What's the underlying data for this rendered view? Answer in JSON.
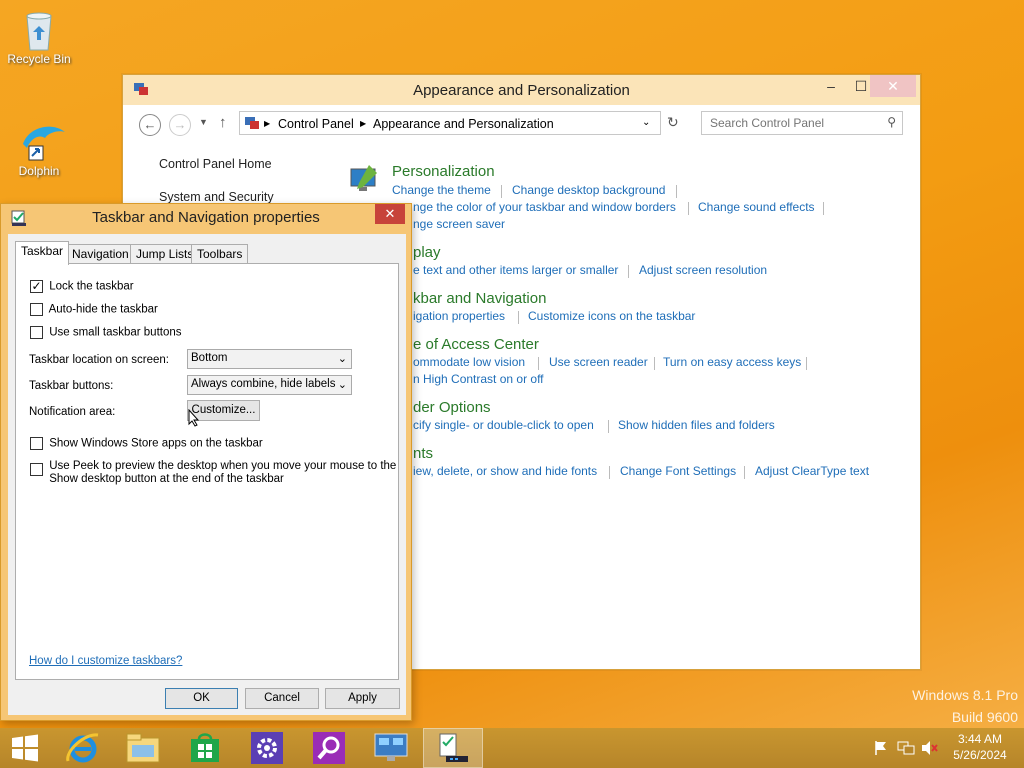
{
  "desktop": {
    "icons": [
      {
        "label": "Recycle Bin",
        "icon": "recycle-bin-icon"
      },
      {
        "label": "Dolphin",
        "icon": "dolphin-icon"
      }
    ],
    "watermark": {
      "line1": "Windows 8.1 Pro",
      "line2": "Build 9600"
    }
  },
  "control_panel": {
    "title": "Appearance and Personalization",
    "breadcrumb": [
      "Control Panel",
      "Appearance and Personalization"
    ],
    "search_placeholder": "Search Control Panel",
    "sidebar": [
      "Control Panel Home",
      "System and Security"
    ],
    "categories": [
      {
        "title": "Personalization",
        "links": [
          "Change the theme",
          "Change desktop background",
          "Change the color of your taskbar and window borders",
          "Change sound effects",
          "Change screen saver"
        ]
      },
      {
        "title": "Display",
        "links": [
          "Make text and other items larger or smaller",
          "Adjust screen resolution"
        ]
      },
      {
        "title": "Taskbar and Navigation",
        "links": [
          "Navigation properties",
          "Customize icons on the taskbar"
        ]
      },
      {
        "title": "Ease of Access Center",
        "links": [
          "Accommodate low vision",
          "Use screen reader",
          "Turn on easy access keys",
          "Turn High Contrast on or off"
        ]
      },
      {
        "title": "Folder Options",
        "links": [
          "Specify single- or double-click to open",
          "Show hidden files and folders"
        ]
      },
      {
        "title": "Fonts",
        "links": [
          "Preview, delete, or show and hide fonts",
          "Change Font Settings",
          "Adjust ClearType text"
        ]
      }
    ],
    "visible_text": {
      "personalization_title": "Personalization",
      "p1": "Change the theme",
      "p2": "Change desktop background",
      "p3": "nge the color of your taskbar and window borders",
      "p4": "Change sound effects",
      "p5": "nge screen saver",
      "display_title": "play",
      "d1": "e text and other items larger or smaller",
      "d2": "Adjust screen resolution",
      "taskbar_title": "kbar and Navigation",
      "t1": "igation properties",
      "t2": "Customize icons on the taskbar",
      "ease_title": "e of Access Center",
      "e1": "ommodate low vision",
      "e2": "Use screen reader",
      "e3": "Turn on easy access keys",
      "e4": "n High Contrast on or off",
      "folder_title": "der Options",
      "f1": "cify single- or double-click to open",
      "f2": "Show hidden files and folders",
      "fonts_title": "nts",
      "fo1": "iew, delete, or show and hide fonts",
      "fo2": "Change Font Settings",
      "fo3": "Adjust ClearType text"
    }
  },
  "dialog": {
    "title": "Taskbar and Navigation properties",
    "tabs": [
      "Taskbar",
      "Navigation",
      "Jump Lists",
      "Toolbars"
    ],
    "checkboxes": {
      "lock": {
        "label": "Lock the taskbar",
        "checked": true
      },
      "autohide": {
        "label": "Auto-hide the taskbar",
        "checked": false
      },
      "small": {
        "label": "Use small taskbar buttons",
        "checked": false
      },
      "store": {
        "label": "Show Windows Store apps on the taskbar",
        "checked": false
      },
      "peek_line1": "Use Peek to preview the desktop when you move your mouse to the",
      "peek_line2": "Show desktop button at the end of the taskbar"
    },
    "location_label": "Taskbar location on screen:",
    "location_value": "Bottom",
    "buttons_label": "Taskbar buttons:",
    "buttons_value": "Always combine, hide labels",
    "notification_label": "Notification area:",
    "customize": "Customize...",
    "help": "How do I customize taskbars?",
    "ok": "OK",
    "cancel": "Cancel",
    "apply": "Apply"
  },
  "taskbar": {
    "apps": [
      "windows-logo-icon",
      "internet-explorer-icon",
      "file-explorer-icon",
      "store-icon",
      "settings-icon",
      "search-icon",
      "control-panel-icon",
      "taskbar-properties-icon"
    ],
    "clock_time": "3:44 AM",
    "clock_date": "5/26/2024"
  },
  "colors": {
    "accent": "#f39c12",
    "link": "#1f6eb8",
    "category": "#2a7a2a"
  }
}
